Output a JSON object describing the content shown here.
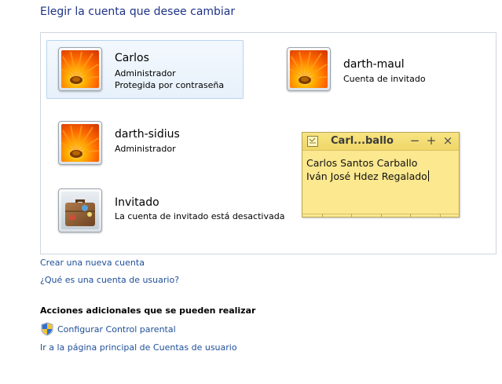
{
  "header": {
    "title": "Elegir la cuenta que desee cambiar"
  },
  "accounts": [
    {
      "name": "Carlos",
      "type": "Administrador",
      "detail": "Protegida por contraseña",
      "picture": "flower-picture"
    },
    {
      "name": "darth-maul",
      "type": "Cuenta de invitado",
      "picture": "flower-picture"
    },
    {
      "name": "darth-sidius",
      "type": "Administrador",
      "picture": "flower-picture"
    },
    {
      "name": "Invitado",
      "type": "La cuenta de invitado está desactivada",
      "picture": "suitcase-picture"
    }
  ],
  "links": {
    "create_account": "Crear una nueva cuenta",
    "what_is_account": "¿Qué es una cuenta de usuario?"
  },
  "additional": {
    "heading": "Acciones adicionales que se pueden realizar",
    "parental_control": "Configurar Control parental",
    "main_page": "Ir a la página principal de Cuentas de usuario"
  },
  "sticky_note": {
    "title": "Carl...ballo",
    "minimize": "−",
    "add": "+",
    "close": "×",
    "lines": [
      "Carlos Santos Carballo",
      "Iván José Hdez Regalado"
    ]
  },
  "colors": {
    "title_blue": "#1e3287",
    "link_blue": "#1e4e98",
    "note_yellow": "#fbe88f"
  }
}
